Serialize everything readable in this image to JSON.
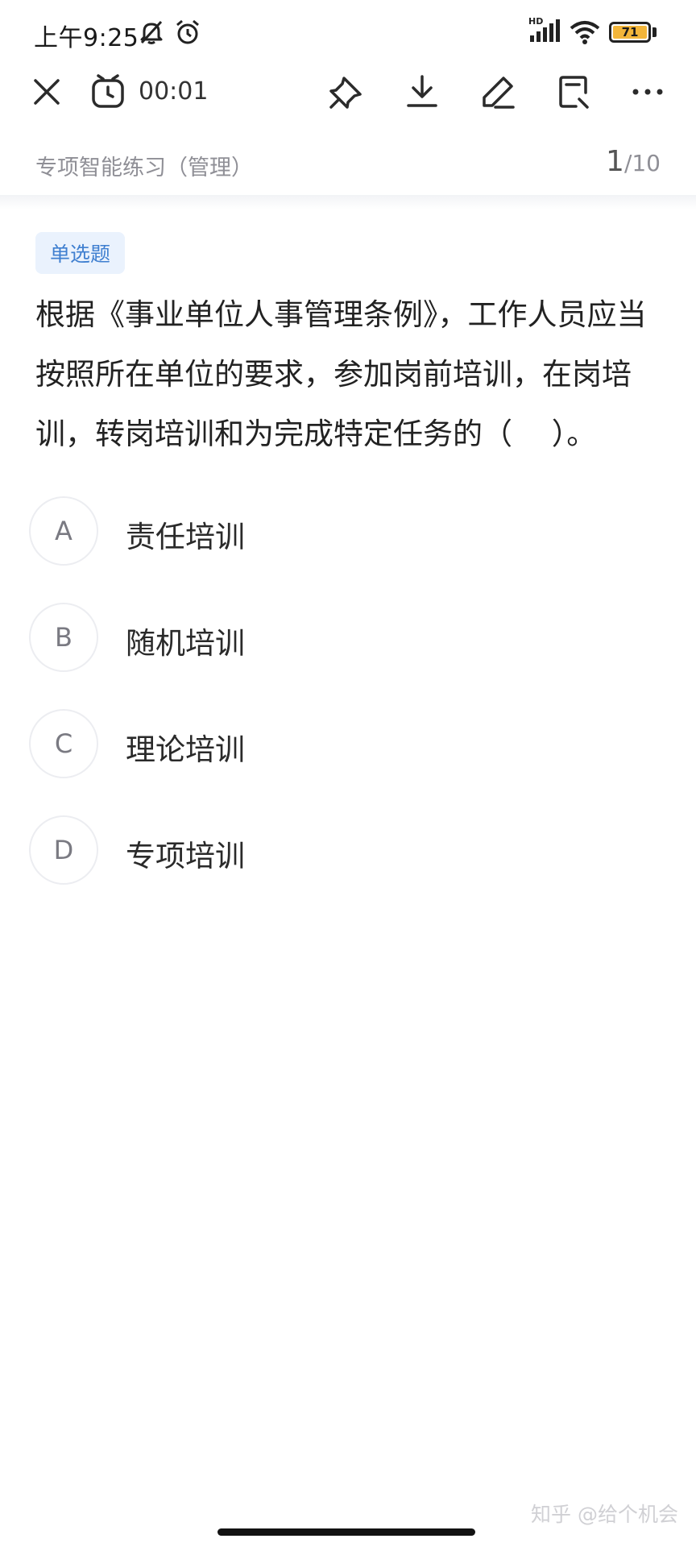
{
  "status_bar": {
    "time": "上午9:25",
    "network_label": "HD",
    "battery_level": "71"
  },
  "toolbar": {
    "timer": "00:01",
    "icons": [
      "close-icon",
      "alarm-clock-icon",
      "pin-icon",
      "download-icon",
      "edit-icon",
      "answer-sheet-icon",
      "more-icon"
    ]
  },
  "header": {
    "practice_title": "专项智能练习（管理）",
    "current": "1",
    "total": "/10"
  },
  "question": {
    "type": "单选题",
    "text": "根据《事业单位人事管理条例》，工作人员应当按照所在单位的要求，参加岗前培训，在岗培训，转岗培训和为完成特定任务的（　 ）。",
    "options": [
      {
        "letter": "A",
        "text": "责任培训"
      },
      {
        "letter": "B",
        "text": "随机培训"
      },
      {
        "letter": "C",
        "text": "理论培训"
      },
      {
        "letter": "D",
        "text": "专项培训"
      }
    ]
  },
  "watermark": "知乎 @给个机会",
  "colors": {
    "accent": "#3f7fd0",
    "tag_bg": "#eaf2fd",
    "battery": "#f2b53a"
  }
}
